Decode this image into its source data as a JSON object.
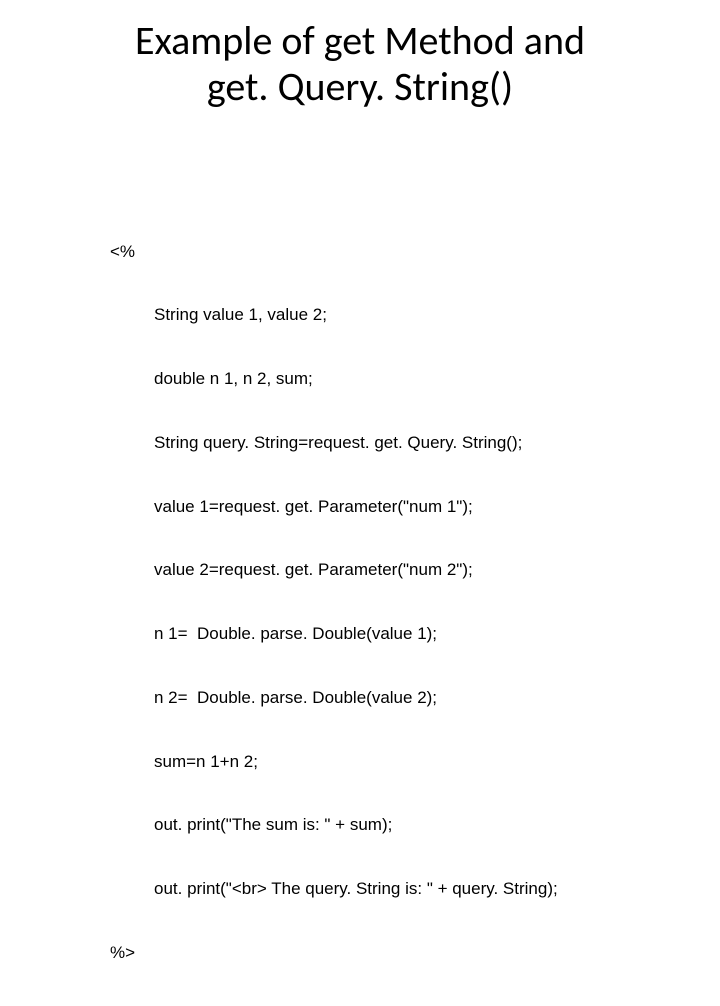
{
  "title_line1": "Example of get Method and",
  "title_line2": "get. Query. String()",
  "code": {
    "open": "<%",
    "lines": [
      "String value 1, value 2;",
      "double n 1, n 2, sum;",
      "String query. String=request. get. Query. String();",
      "value 1=request. get. Parameter(\"num 1\");",
      "value 2=request. get. Parameter(\"num 2\");",
      "n 1=  Double. parse. Double(value 1);",
      "n 2=  Double. parse. Double(value 2);",
      "sum=n 1+n 2;",
      "out. print(\"The sum is: \" + sum);",
      "out. print(\"<br> The query. String is: \" + query. String);"
    ],
    "close": "%>"
  }
}
